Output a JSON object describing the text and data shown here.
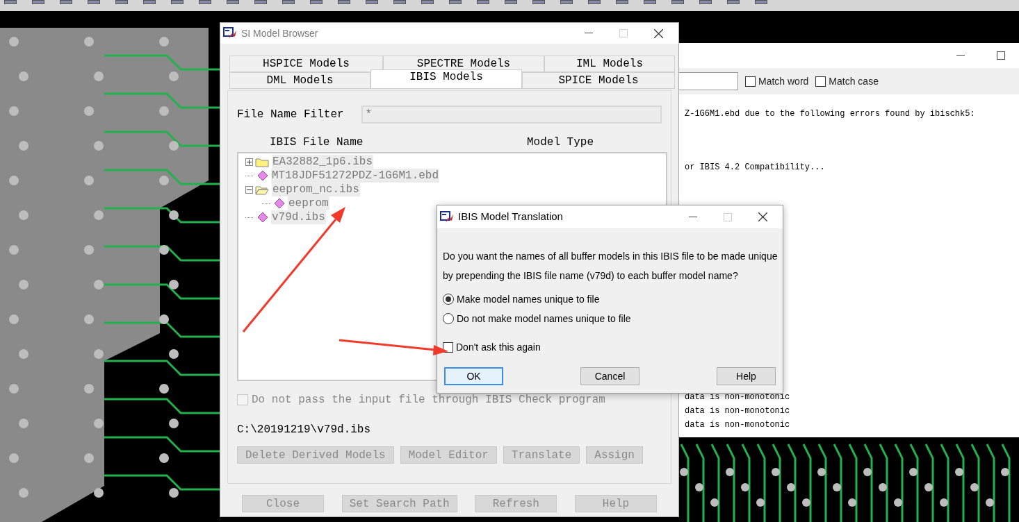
{
  "log_window": {
    "match_word": {
      "label": "Match word",
      "checked": false
    },
    "match_case": {
      "label": "Match case",
      "checked": false
    },
    "lines_top": [
      "Z-1G6M1.ebd due to the following errors found by ibischk5:"
    ],
    "lines_mid": [
      "or IBIS 4.2 Compatibility..."
    ],
    "lines_bottom": [
      "data is non-monotonic",
      "data is non-monotonic",
      "data is non-monotonic"
    ]
  },
  "si_browser": {
    "title": "SI Model Browser",
    "tab_rows": [
      [
        {
          "label": "HSPICE Models",
          "selected": false
        },
        {
          "label": "SPECTRE Models",
          "selected": false
        },
        {
          "label": "IML Models",
          "selected": false
        }
      ],
      [
        {
          "label": "DML Models",
          "selected": false
        },
        {
          "label": "IBIS Models",
          "selected": true
        },
        {
          "label": "SPICE Models",
          "selected": false
        }
      ]
    ],
    "filter": {
      "label": "File Name Filter",
      "value": "*"
    },
    "columns": [
      "IBIS File Name",
      "Model Type"
    ],
    "tree": [
      {
        "label": "EA32882_1p6.ibs",
        "kind": "folder",
        "expanded": false
      },
      {
        "label": "MT18JDF51272PDZ-1G6M1.ebd",
        "kind": "file"
      },
      {
        "label": "eeprom_nc.ibs",
        "kind": "folder",
        "expanded": true,
        "children": [
          {
            "label": "eeprom",
            "kind": "file"
          }
        ]
      },
      {
        "label": "v79d.ibs",
        "kind": "file"
      }
    ],
    "check_option": {
      "label": "Do not pass the input file through IBIS Check program",
      "checked": false,
      "disabled": true
    },
    "path": "C:\\20191219\\v79d.ibs",
    "action_buttons": [
      {
        "label": "Delete Derived Models",
        "disabled": true
      },
      {
        "label": "Model Editor",
        "disabled": true
      },
      {
        "label": "Translate",
        "disabled": true
      },
      {
        "label": "Assign",
        "disabled": true
      }
    ],
    "bottom_buttons": [
      {
        "label": "Close",
        "disabled": true
      },
      {
        "label": "Set Search Path",
        "disabled": true
      },
      {
        "label": "Refresh",
        "disabled": true
      },
      {
        "label": "Help",
        "disabled": true
      }
    ]
  },
  "dialog": {
    "title": "IBIS Model Translation",
    "message_lines": [
      "Do you want the names of all buffer models in this IBIS file to be made unique",
      "by prepending the IBIS file name (v79d) to each buffer model name?"
    ],
    "options": [
      {
        "label": "Make model names unique to file",
        "selected": true
      },
      {
        "label": "Do not make model names unique to file",
        "selected": false
      }
    ],
    "dont_ask": {
      "label": "Don't ask this again",
      "checked": false
    },
    "buttons": [
      {
        "label": "OK",
        "default": true
      },
      {
        "label": "Cancel",
        "default": false
      },
      {
        "label": "Help",
        "default": false
      }
    ]
  }
}
